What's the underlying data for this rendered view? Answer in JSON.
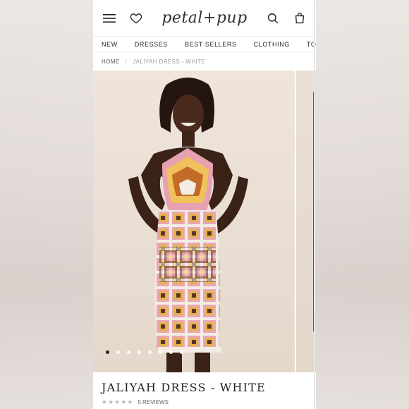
{
  "brand": {
    "logo_text": "petal+pup"
  },
  "header": {
    "menu_icon": "hamburger-menu-icon",
    "wishlist_icon": "heart-icon",
    "search_icon": "search-icon",
    "cart_icon": "shopping-bag-icon"
  },
  "nav": {
    "items": [
      "NEW",
      "DRESSES",
      "BEST SELLERS",
      "CLOTHING",
      "TOPS"
    ]
  },
  "breadcrumb": {
    "home": "HOME",
    "separator": "/",
    "current": "JALIYAH DRESS - WHITE"
  },
  "gallery": {
    "dot_count": 8,
    "active_index": 0
  },
  "product": {
    "title": "JALIYAH DRESS - WHITE",
    "stars": "★★★★★",
    "reviews_text": "5 REVIEWS"
  },
  "colors": {
    "accent": "#222222",
    "page_bg": "#ffffff",
    "photo_bg": "#ece2d8"
  }
}
